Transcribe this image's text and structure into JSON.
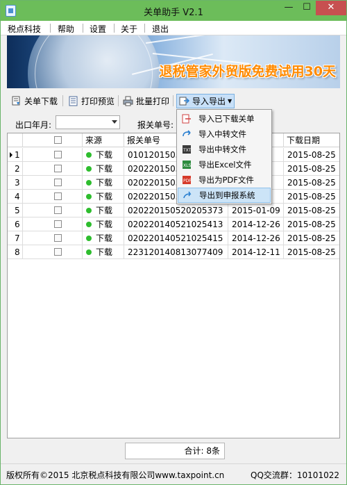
{
  "window": {
    "title": "关单助手  V2.1",
    "min_glyph": "—",
    "max_glyph": "☐",
    "close_glyph": "✕"
  },
  "menu": [
    "税点科技",
    "帮助",
    "设置",
    "关于",
    "退出"
  ],
  "banner": {
    "text": "退税管家外贸版免费试用30天"
  },
  "toolbar": {
    "download": "关单下载",
    "print_preview": "打印预览",
    "batch_print": "批量打印",
    "import_export": "导入导出"
  },
  "filter": {
    "year_month_label": "出口年月:",
    "declaration_no_label": "报关单号:"
  },
  "dropdown": {
    "items": [
      "导入已下载关单",
      "导入中转文件",
      "导出中转文件",
      "导出Excel文件",
      "导出为PDF文件",
      "导出到申报系统"
    ],
    "hovered_index": 5
  },
  "grid": {
    "columns": [
      "",
      "",
      "来源",
      "报关单号",
      "",
      "下载日期"
    ],
    "rows": [
      {
        "index": "1",
        "source": "下载",
        "decl_no": "0101201505100",
        "export_date": "",
        "download_date": "2015-08-25",
        "current": true
      },
      {
        "index": "2",
        "source": "下载",
        "decl_no": "0202201505200",
        "export_date": "",
        "download_date": "2015-08-25",
        "current": false
      },
      {
        "index": "3",
        "source": "下载",
        "decl_no": "0202201505200",
        "export_date": "",
        "download_date": "2015-08-25",
        "current": false
      },
      {
        "index": "4",
        "source": "下载",
        "decl_no": "0202201505200",
        "export_date": "",
        "download_date": "2015-08-25",
        "current": false
      },
      {
        "index": "5",
        "source": "下载",
        "decl_no": "020220150520205373",
        "export_date": "2015-01-09",
        "download_date": "2015-08-25",
        "current": false
      },
      {
        "index": "6",
        "source": "下载",
        "decl_no": "020220140521025413",
        "export_date": "2014-12-26",
        "download_date": "2015-08-25",
        "current": false
      },
      {
        "index": "7",
        "source": "下载",
        "decl_no": "020220140521025415",
        "export_date": "2014-12-26",
        "download_date": "2015-08-25",
        "current": false
      },
      {
        "index": "8",
        "source": "下载",
        "decl_no": "223120140813077409",
        "export_date": "2014-12-11",
        "download_date": "2015-08-25",
        "current": false
      }
    ]
  },
  "summary": {
    "text": "合计: 8条"
  },
  "status": {
    "copyright": "版权所有©2015 北京税点科技有限公司www.taxpoint.cn",
    "qq": "QQ交流群：10101022"
  },
  "colors": {
    "titlebar": "#6cbd5a",
    "close": "#c75050",
    "banner_text": "#ff8a00",
    "status_dot": "#2ebd2e",
    "menu_hover": "#cce4f7"
  }
}
